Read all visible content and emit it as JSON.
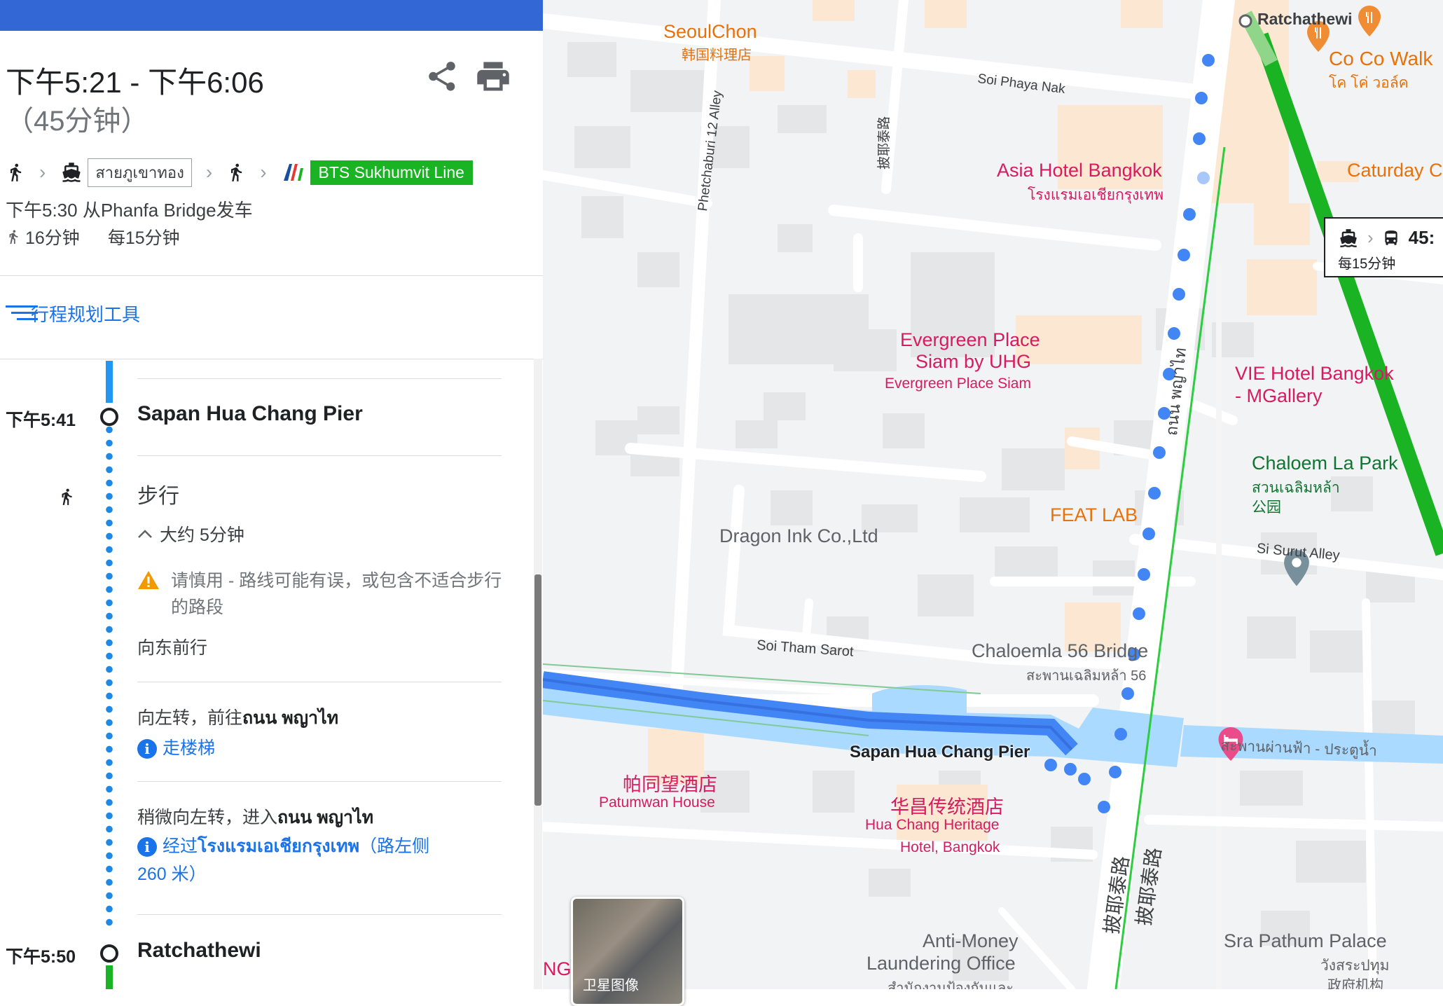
{
  "summary": {
    "time_range": "下午5:21 - 下午6:06",
    "duration": "（45分钟）",
    "boat_line": "สายภูเขาทอง",
    "bts_line": "BTS Sukhumvit Line",
    "depart": "下午5:30 从Phanfa Bridge发车",
    "walk": "16分钟",
    "frequency": "每15分钟"
  },
  "planner": {
    "label": "行程规划工具"
  },
  "steps": {
    "stop1_time": "下午5:41",
    "stop1_name": "Sapan Hua Chang Pier",
    "walk_title": "步行",
    "walk_duration": "大约 5分钟",
    "warning": "请慎用 - 路线可能有误，或包含不适合步行的路段",
    "head_east": "向东前行",
    "turn_left": "向左转，前往",
    "turn_left_road": "ถนน พญาไท",
    "stairs": "走楼梯",
    "slight_left": "稍微向左转，进入",
    "slight_left_road": "ถนน พญาไท",
    "pass_prefix": "经过",
    "pass_place": "โรงแรมเอเชียกรุงเทพ",
    "pass_suffix": "（路左侧 260 米）",
    "stop2_time": "下午5:50",
    "stop2_name": "Ratchathewi"
  },
  "map": {
    "popup_time": "45:",
    "popup_freq": "每15分钟",
    "satellite": "卫星图像",
    "labels": {
      "ratchathewi": "Ratchathewi",
      "seoulchon": "SeoulChon",
      "seoulchon_cn": "韩国料理店",
      "cocowalk": "Co Co Walk",
      "cocowalk_th": "โค โค่ วอล์ค",
      "caturday": "Caturday C",
      "soi_phaya_nak": "Soi Phaya Nak",
      "phetchaburi": "Phetchaburi 12 Alley",
      "asia_hotel": "Asia Hotel Bangkok",
      "asia_hotel_th": "โรงแรมเอเชียกรุงเทพ",
      "pathumwan_road": "披耶泰路",
      "evergreen1": "Evergreen Place",
      "evergreen2": "Siam by UHG",
      "evergreen3": "Evergreen Place Siam",
      "vie1": "VIE Hotel Bangkok",
      "vie2": "- MGallery",
      "phaya_thai_th": "ถนน พญาไท",
      "chaloem1": "Chaloem La Park",
      "chaloem2": "สวนเฉลิมหล้า",
      "chaloem3": "公园",
      "feat_lab": "FEAT LAB",
      "dragon": "Dragon Ink Co.,Ltd",
      "si_surut": "Si Surut Alley",
      "soi_tham": "Soi Tham Sarot",
      "chaloemla56": "Chaloemla 56 Bridge",
      "chaloemla56_th": "สะพานเฉลิมหล้า 56",
      "sapan_pier": "Sapan Hua Chang Pier",
      "sapan_phan": "สะพานผ่านฟ้า - ประตูน้ำ",
      "patumwan_cn": "帕同望酒店",
      "patumwan_en": "Patumwan House",
      "huachang_cn": "华昌传统酒店",
      "huachang_en1": "Hua Chang Heritage",
      "huachang_en2": "Hotel, Bangkok",
      "road_cn1": "披耶泰路",
      "road_cn2": "披耶泰路",
      "amlo1": "Anti-Money",
      "amlo2": "Laundering Office",
      "amlo_th": "สำนักงานป้องกันและ",
      "sra_pathum": "Sra Pathum Palace",
      "sra_pathum_th": "วังสระปทุม",
      "sra_pathum_cn": "政府机构",
      "ng": "NG"
    }
  },
  "colors": {
    "accent": "#1a73e8",
    "route_blue": "#4285f4",
    "bts_green": "#19b324",
    "poi_pink": "#d81b60",
    "poi_orange": "#e8710a"
  },
  "icons": [
    "share-icon",
    "print-icon",
    "walk-icon",
    "boat-icon",
    "bts-logo-icon",
    "planner-icon",
    "warning-icon",
    "info-icon",
    "chevron-up-icon",
    "bus-icon",
    "hotel-icon",
    "restaurant-icon",
    "bar-icon",
    "cafe-icon",
    "park-icon",
    "pin-icon",
    "bridge-icon",
    "government-icon"
  ]
}
